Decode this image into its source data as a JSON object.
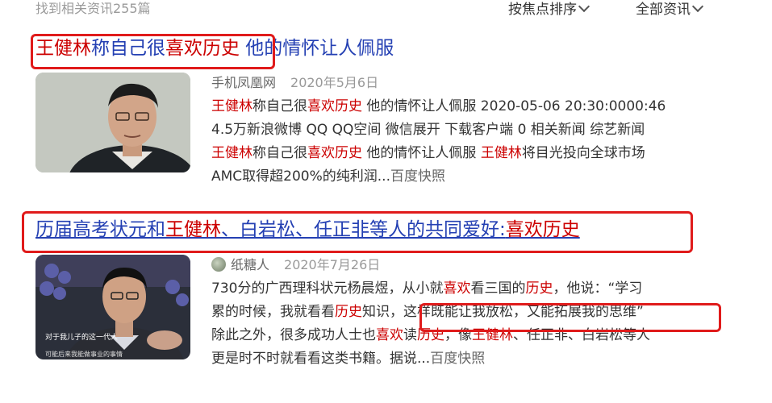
{
  "results_count": "找到相关资讯255篇",
  "sort": {
    "relevance": "按焦点排序",
    "category": "全部资讯"
  },
  "results": [
    {
      "title_hl": "王健林",
      "title_a": "称自己很",
      "title_hl2": "喜欢历史",
      "title_b": " 他的情怀让人佩服",
      "source": "手机凤凰网",
      "date": "2020年5月6日",
      "lines": [
        {
          "hl1": "王健林",
          "t1": "称自己很",
          "hl2": "喜欢历史",
          "t2": " 他的情怀让人佩服 2020-05-06 20:30:0000:46"
        },
        {
          "t1": "4.5万新浪微博 QQ QQ空间 微信展开 下载客户端 0 相关新闻 综艺新闻"
        },
        {
          "hl1": "王健林",
          "t1": "称自己很",
          "hl2": "喜欢历史",
          "t2": " 他的情怀让人佩服 ",
          "hl3": "王健林",
          "t3": "将目光投向全球市场"
        },
        {
          "t1": "AMC取得超200%的纯利润...",
          "link": "百度快照"
        }
      ]
    },
    {
      "title_a": "历届高考状元和",
      "title_hl": "王健林",
      "title_b": "、白岩松、任正非等人的共同爱好:",
      "title_hl2": "喜欢历史",
      "source": "纸糖人",
      "date": "2020年7月26日",
      "lines": [
        {
          "t1": "730分的广西理科状元杨晨煜，从小就",
          "hl1": "喜欢",
          "t2": "看三国的",
          "hl2": "历史",
          "t3": "，他说：“学习"
        },
        {
          "t1": "累的时候，我就看看",
          "hl1": "历史",
          "t2": "知识，",
          "box": "这样既能让我放松，又能拓展我的思维”"
        },
        {
          "t1": "除此之外，很多成功人士也",
          "hl1": "喜欢",
          "t2": "读",
          "hl2": "历史",
          "t3": "，像",
          "hl3": "王健林",
          "t4": "、任正非、白岩松等人"
        },
        {
          "t1": "更是时不时就看看这类书籍。据说...",
          "link": "百度快照"
        }
      ],
      "thumb_caption_1": "对于我儿子的这一代人",
      "thumb_caption_2": "可能后来我能做事业的事情"
    }
  ],
  "colors": {
    "highlight": "#cc0000",
    "link": "#2440b3",
    "annotation": "#e01b1b"
  }
}
